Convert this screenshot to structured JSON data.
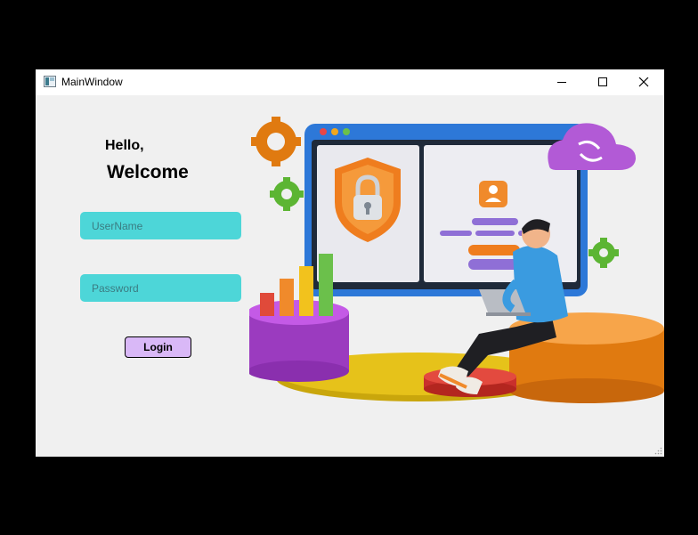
{
  "window": {
    "title": "MainWindow",
    "icon": "app-window-icon"
  },
  "controls": {
    "minimize": "minimize-icon",
    "maximize": "maximize-icon",
    "close": "close-icon"
  },
  "greeting": {
    "hello": "Hello,",
    "welcome": "Welcome"
  },
  "form": {
    "username_placeholder": "UserName",
    "password_placeholder": "Password",
    "login_label": "Login"
  },
  "colors": {
    "input_bg": "#4dd6d8",
    "login_bg": "#d9b8f7",
    "window_bg": "#f0f0f0"
  },
  "illustration": {
    "subject": "security-login-illustration"
  }
}
